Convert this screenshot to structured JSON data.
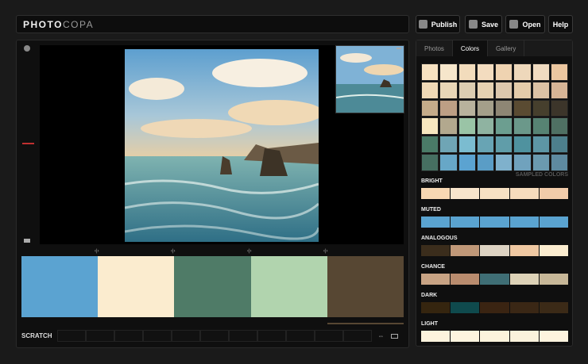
{
  "app": {
    "logo_bold": "PHOTO",
    "logo_light": "COPA"
  },
  "toolbar": {
    "publish": "Publish",
    "save": "Save",
    "open": "Open",
    "help": "Help"
  },
  "tabs": [
    "Photos",
    "Colors",
    "Gallery"
  ],
  "active_tab": "Colors",
  "palette": [
    "#5ba3d1",
    "#fbeccf",
    "#4f7b67",
    "#b1d4ae",
    "#574733"
  ],
  "scratch_label": "SCRATCH",
  "sampled_label": "SAMPLED COLORS",
  "sampled_colors": [
    "#f7e2c1",
    "#f6e6cb",
    "#f2dcbc",
    "#f3dcbf",
    "#efd3b1",
    "#eed8bb",
    "#f0dbc1",
    "#ecc7a0",
    "#f0d9b6",
    "#e8d6b7",
    "#dccdb1",
    "#e6d2b2",
    "#ddc8ad",
    "#e4ccaa",
    "#dcc2a4",
    "#d7b596",
    "#c5ac8a",
    "#bd9f85",
    "#b8b29d",
    "#a49f8a",
    "#8e8674",
    "#5a4b32",
    "#463f2d",
    "#3c352a",
    "#f7e7bf",
    "#b2a88e",
    "#9ac4a6",
    "#8fb3a1",
    "#6c9e90",
    "#6b988a",
    "#578373",
    "#4f7063",
    "#4a7b67",
    "#6fa5b5",
    "#7bbcd0",
    "#68a4b4",
    "#609da9",
    "#4f929f",
    "#5d96a5",
    "#4d7f8c",
    "#466f61",
    "#67a7c7",
    "#5ba3d1",
    "#5a9dc6",
    "#7fb1cc",
    "#70a2bd",
    "#6b9aaf",
    "#5e8aa0"
  ],
  "groups": [
    {
      "label": "BRIGHT",
      "colors": [
        "#f8d8b3",
        "#f8e5cc",
        "#f7e1c3",
        "#f6dcbd",
        "#f2ccaa"
      ]
    },
    {
      "label": "MUTED",
      "colors": [
        "#5aa3d0",
        "#5aa3d0",
        "#5aa3d0",
        "#5aa3d0",
        "#5aa3d0"
      ]
    },
    {
      "label": "ANALOGOUS",
      "colors": [
        "#3b2d1c",
        "#c09878",
        "#ddd3c3",
        "#efc8a2",
        "#fbeccf"
      ]
    },
    {
      "label": "CHANCE",
      "colors": [
        "#c8a384",
        "#b98c6e",
        "#3f6e75",
        "#ddd2b7",
        "#c7b798"
      ]
    },
    {
      "label": "DARK",
      "colors": [
        "#35250f",
        "#0f4a4d",
        "#3a2412",
        "#3a2715",
        "#3b2a17"
      ]
    },
    {
      "label": "LIGHT",
      "colors": [
        "#fdf3dd",
        "#fdf4df",
        "#fcf3dc",
        "#fbf2dc",
        "#fdf3de"
      ]
    }
  ]
}
